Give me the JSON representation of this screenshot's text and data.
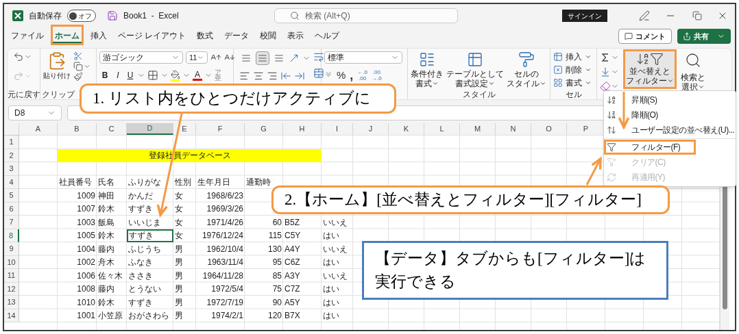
{
  "title_bar": {
    "autosave_label": "自動保存",
    "autosave": {
      "on": false,
      "label": "オフ"
    },
    "title": "Book1  -  Excel",
    "sign_in": "サインイン"
  },
  "search": {
    "placeholder": "検索 (Alt+Q)"
  },
  "tabs": [
    {
      "label": "ファイル",
      "selected": false,
      "highlighted": false
    },
    {
      "label": "ホーム",
      "selected": true,
      "highlighted": true
    },
    {
      "label": "挿入",
      "selected": false,
      "highlighted": false
    },
    {
      "label": "ページ レイアウト",
      "selected": false,
      "highlighted": false
    },
    {
      "label": "数式",
      "selected": false,
      "highlighted": false
    },
    {
      "label": "データ",
      "selected": false,
      "highlighted": false
    },
    {
      "label": "校閲",
      "selected": false,
      "highlighted": false
    },
    {
      "label": "表示",
      "selected": false,
      "highlighted": false
    },
    {
      "label": "ヘルプ",
      "selected": false,
      "highlighted": false
    }
  ],
  "comment_button": "コメント",
  "share_button": "共有",
  "ribbon": {
    "undo": {
      "label": "元に戻す"
    },
    "clipboard": {
      "paste": "貼り付け",
      "label": "クリップ"
    },
    "font": {
      "name": "游ゴシック",
      "size": "11",
      "bold": "B",
      "italic": "I",
      "underline": "U",
      "font_color": "A",
      "phonetic_top": "ア",
      "phonetic_bottom": "亜"
    },
    "alignment": {
      "vertical": [
        {
          "selected": false
        },
        {
          "selected": true
        },
        {
          "selected": false
        }
      ]
    },
    "number": {
      "format": "標準",
      "percent": "%",
      "comma": ",",
      "increase_decimal": {
        "top": "←.0",
        "bottom": ".00"
      },
      "decrease_decimal": {
        "top": ".00",
        "bottom": "→.0"
      }
    },
    "styles": {
      "buttons": [
        {
          "line1": "条件付き",
          "line2": "書式",
          "kind": "conditional"
        },
        {
          "line1": "テーブルとして",
          "line2": "書式設定",
          "kind": "table"
        },
        {
          "line1": "セルの",
          "line2": "スタイル",
          "kind": "cell-style"
        }
      ],
      "label": "スタイル"
    },
    "cells": {
      "buttons": [
        {
          "label": "挿入",
          "kind": "insert"
        },
        {
          "label": "削除",
          "kind": "delete"
        },
        {
          "label": "書式",
          "kind": "format"
        }
      ],
      "label": "セル"
    },
    "editing": {
      "sort_filter": {
        "line1": "並べ替えと",
        "line2": "フィルター",
        "highlighted": true
      },
      "find": {
        "line1": "検索と",
        "line2": "選択"
      }
    }
  },
  "sort_menu": {
    "sections": [
      [
        {
          "label": "昇順(S)",
          "kind": "ascending",
          "disabled": false,
          "highlighted": false
        },
        {
          "label": "降順(O)",
          "kind": "descending",
          "disabled": false,
          "highlighted": false
        },
        {
          "label": "ユーザー設定の並べ替え(U)...",
          "kind": "custom",
          "disabled": false,
          "highlighted": false
        }
      ],
      [
        {
          "label": "フィルター(F)",
          "kind": "filter",
          "disabled": false,
          "highlighted": true
        },
        {
          "label": "クリア(C)",
          "kind": "clear",
          "disabled": true,
          "highlighted": false
        },
        {
          "label": "再適用(Y)",
          "kind": "reapply",
          "disabled": true,
          "highlighted": false
        }
      ]
    ]
  },
  "name_box": "D8",
  "sheet": {
    "columns": [
      {
        "letter": "A",
        "selected": false
      },
      {
        "letter": "B",
        "selected": false
      },
      {
        "letter": "C",
        "selected": false
      },
      {
        "letter": "D",
        "selected": true
      },
      {
        "letter": "E",
        "selected": false
      },
      {
        "letter": "F",
        "selected": false
      },
      {
        "letter": "G",
        "selected": false
      },
      {
        "letter": "H",
        "selected": false
      },
      {
        "letter": "I",
        "selected": false
      },
      {
        "letter": "J",
        "selected": false
      },
      {
        "letter": "K",
        "selected": false
      },
      {
        "letter": "L",
        "selected": false
      },
      {
        "letter": "M",
        "selected": false
      },
      {
        "letter": "N",
        "selected": false
      },
      {
        "letter": "O",
        "selected": false
      },
      {
        "letter": "P",
        "selected": false
      }
    ],
    "rows": [
      {
        "number": "1",
        "selected": false,
        "kind": "empty"
      },
      {
        "number": "2",
        "selected": false,
        "kind": "title",
        "title": "登録社員データベース"
      },
      {
        "number": "3",
        "selected": false,
        "kind": "empty"
      },
      {
        "number": "4",
        "selected": false,
        "kind": "header",
        "cells": {
          "B": "社員番号",
          "C": "氏名",
          "D": "ふりがな",
          "E": "性別",
          "F": "生年月日",
          "G": "通勤時"
        }
      },
      {
        "number": "5",
        "selected": false,
        "kind": "record",
        "cells": {
          "B": "1009",
          "C": "神田",
          "D": "かんだ",
          "E": "女",
          "F": "1968/6/23"
        }
      },
      {
        "number": "6",
        "selected": false,
        "kind": "record",
        "cells": {
          "B": "1007",
          "C": "鈴木",
          "D": "すずき",
          "E": "女",
          "F": "1969/3/26"
        }
      },
      {
        "number": "7",
        "selected": false,
        "kind": "record",
        "cells": {
          "B": "1003",
          "C": "飯島",
          "D": "いいじま",
          "E": "女",
          "F": "1971/4/26",
          "G": "60",
          "H": "B5Z",
          "I": "いいえ"
        }
      },
      {
        "number": "8",
        "selected": true,
        "kind": "record",
        "cells": {
          "B": "1005",
          "C": "鈴木",
          "D": "すずき",
          "E": "女",
          "F": "1976/12/24",
          "G": "115",
          "H": "C5Y",
          "I": "はい"
        }
      },
      {
        "number": "9",
        "selected": false,
        "kind": "record",
        "cells": {
          "B": "1004",
          "C": "藤内",
          "D": "ふじうち",
          "E": "男",
          "F": "1962/10/4",
          "G": "130",
          "H": "A4Y",
          "I": "いいえ"
        }
      },
      {
        "number": "10",
        "selected": false,
        "kind": "record",
        "cells": {
          "B": "1002",
          "C": "舟木",
          "D": "ふなき",
          "E": "男",
          "F": "1963/11/4",
          "G": "95",
          "H": "C6Z",
          "I": "はい"
        }
      },
      {
        "number": "11",
        "selected": false,
        "kind": "record",
        "cells": {
          "B": "1006",
          "C": "佐々木",
          "D": "ささき",
          "E": "男",
          "F": "1964/11/28",
          "G": "85",
          "H": "A3Y",
          "I": "いいえ"
        }
      },
      {
        "number": "12",
        "selected": false,
        "kind": "record",
        "cells": {
          "B": "1008",
          "C": "藤内",
          "D": "とうない",
          "E": "男",
          "F": "1972/5/4",
          "G": "75",
          "H": "C7Z",
          "I": "はい"
        }
      },
      {
        "number": "13",
        "selected": false,
        "kind": "record",
        "cells": {
          "B": "1010",
          "C": "鈴木",
          "D": "すずき",
          "E": "男",
          "F": "1972/7/19",
          "G": "90",
          "H": "A5Y",
          "I": "はい"
        }
      },
      {
        "number": "14",
        "selected": false,
        "kind": "record",
        "cells": {
          "B": "1001",
          "C": "小笠原",
          "D": "おがさわら",
          "E": "男",
          "F": "1974/2/1",
          "G": "120",
          "H": "B7X",
          "I": "はい"
        }
      }
    ]
  },
  "callouts": [
    {
      "kind": "step",
      "lines": [
        "1.  リスト内をひとつだけアクティブに"
      ]
    },
    {
      "kind": "step",
      "lines": [
        "2.【ホーム】[並べ替えとフィルター][フィルター]"
      ]
    },
    {
      "kind": "note",
      "lines": [
        "【データ】タブからも[フィルター]は",
        "実行できる"
      ]
    }
  ]
}
